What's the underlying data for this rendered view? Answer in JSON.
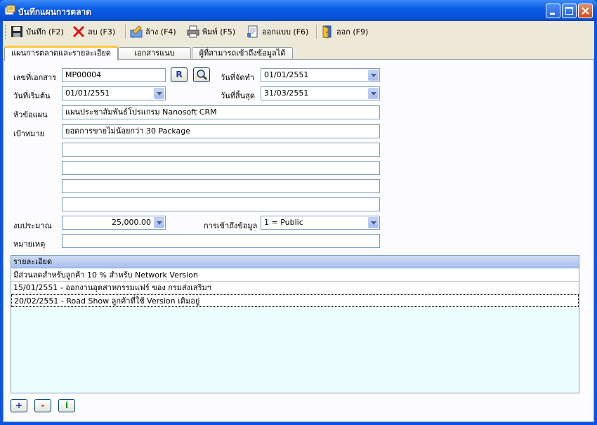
{
  "window": {
    "title": "บันทึกแผนการตลาด",
    "icon": "app-icon"
  },
  "toolbar": {
    "save": "บันทึก (F2)",
    "delete": "ลบ (F3)",
    "clear": "ล้าง (F4)",
    "print": "พิมพ์ (F5)",
    "design": "ออกแบบ (F6)",
    "exit": "ออก (F9)"
  },
  "tabs": [
    {
      "label": "แผนการตลาดและรายละเอียด"
    },
    {
      "label": "เอกสารแนบ"
    },
    {
      "label": "ผู้ที่สามารถเข้าถึงข้อมูลได้"
    }
  ],
  "form": {
    "doc_no_label": "เลขที่เอกสาร",
    "doc_no": "MP00004",
    "r_button": "R",
    "created_label": "วันที่จัดทำ",
    "created": "01/01/2551",
    "start_label": "วันที่เริ่มต้น",
    "start": "01/01/2551",
    "end_label": "วันที่สิ้นสุด",
    "end": "31/03/2551",
    "topic_label": "หัวข้อแผน",
    "topic": "แผนประชาสัมพันธ์โปรแกรม Nanosoft CRM",
    "goal_label": "เป้าหมาย",
    "goals": [
      "ยอดการขายไม่น้อยกว่า 30 Package",
      "",
      "",
      "",
      ""
    ],
    "budget_label": "งบประมาณ",
    "budget": "25,000.00",
    "access_label": "การเข้าถึงข้อมูล",
    "access": "1 = Public",
    "note_label": "หมายเหตุ",
    "note": ""
  },
  "details": {
    "header": "รายละเอียด",
    "rows": [
      "มีส่วนลดสำหรับลูกค้า 10 % สำหรับ Network Version",
      "15/01/2551 - ออกงานอุตสาหกรรมแฟร์ ของ กรมส่งเสริมฯ",
      "20/02/2551 - Road Show ลูกค้าที่ใช้ Version เดิมอยู่"
    ]
  },
  "bottom_buttons": {
    "add": "+",
    "remove": "-",
    "info": "i"
  },
  "colors": {
    "titlebar": "#0a5ee8",
    "tab_highlight": "#ffc83c",
    "grid_bg": "#eefdff"
  }
}
